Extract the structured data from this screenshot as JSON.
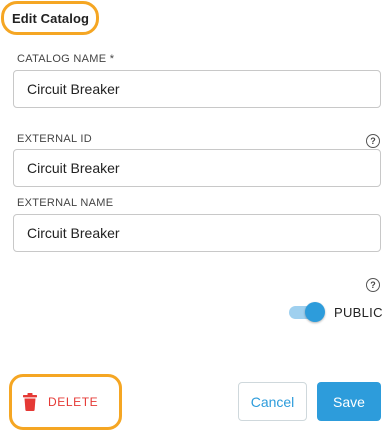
{
  "header": {
    "title": "Edit Catalog"
  },
  "form": {
    "catalog_name": {
      "label": "CATALOG NAME *",
      "value": "Circuit Breaker"
    },
    "external_id": {
      "label": "EXTERNAL ID",
      "value": "Circuit Breaker",
      "help_icon": "help-circle-icon",
      "help_glyph": "?"
    },
    "external_name": {
      "label": "EXTERNAL NAME",
      "value": "Circuit Breaker"
    },
    "visibility": {
      "help_icon": "help-circle-icon",
      "help_glyph": "?",
      "label": "PUBLIC",
      "enabled": true
    }
  },
  "actions": {
    "delete_label": "DELETE",
    "delete_icon": "trash-icon",
    "cancel_label": "Cancel",
    "save_label": "Save"
  },
  "colors": {
    "accent": "#2d9cdb",
    "danger": "#e53935",
    "highlight": "#f5a623"
  }
}
